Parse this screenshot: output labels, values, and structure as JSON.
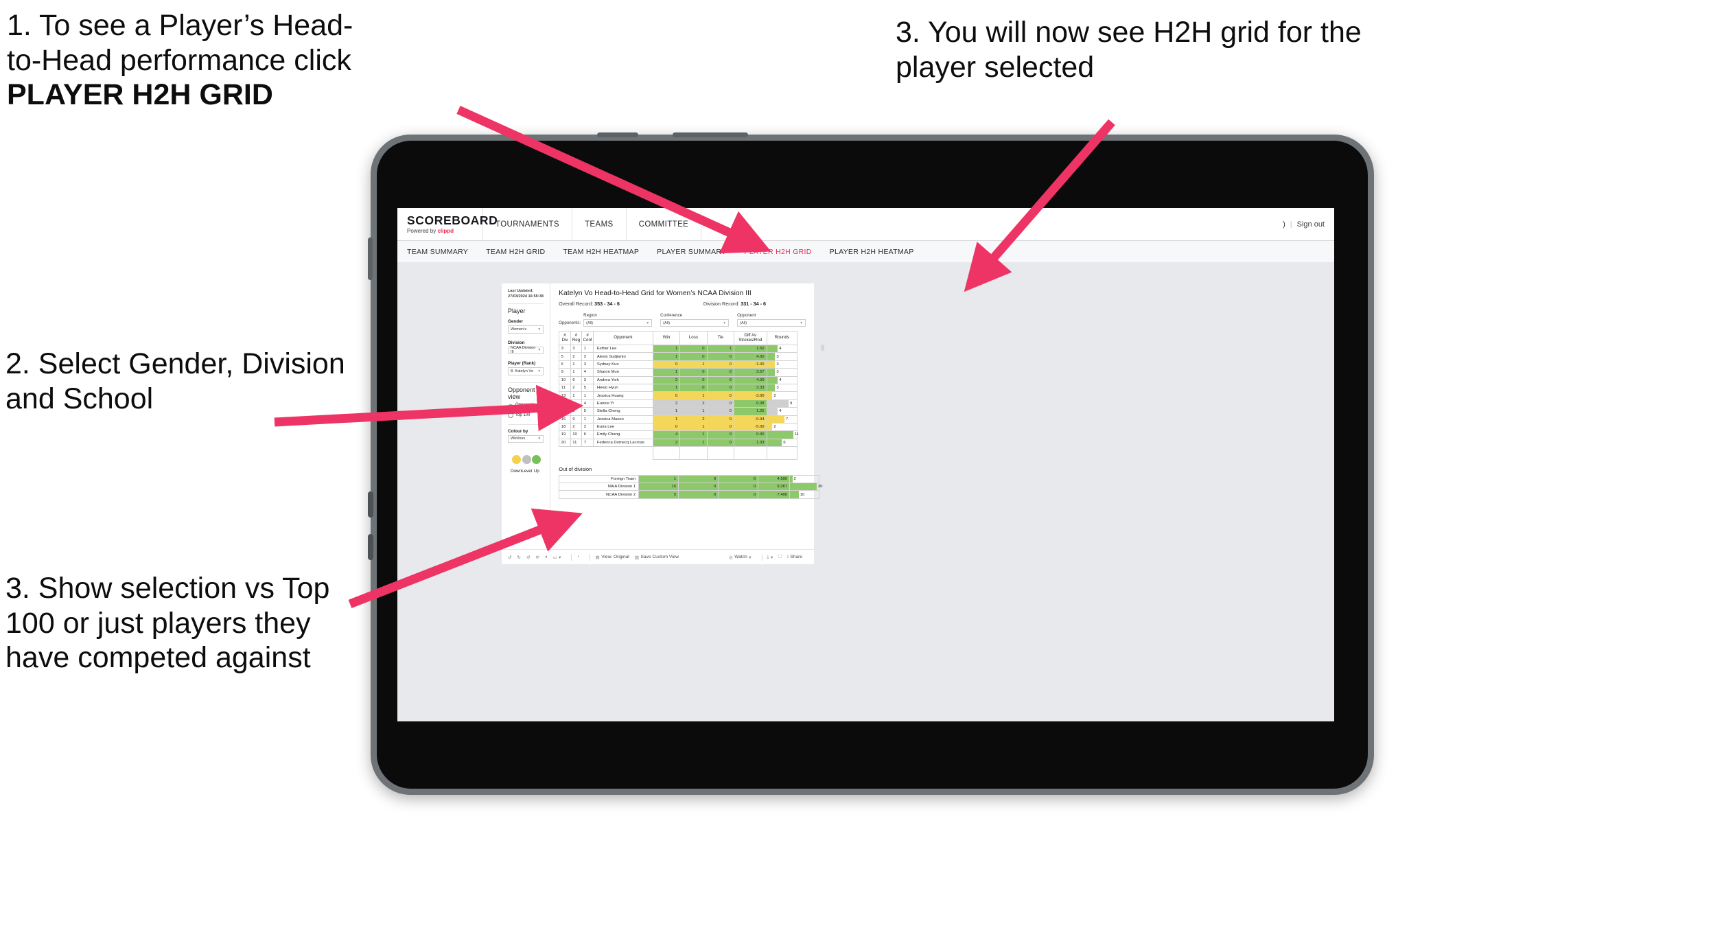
{
  "annotations": {
    "a1_line1": "1. To see a Player’s Head-",
    "a1_line2": "to-Head performance click",
    "a1_bold": "PLAYER H2H GRID",
    "a2": "2. Select Gender, Division and School",
    "a3": "3. Show selection vs Top 100 or just players they have competed against",
    "a4": "3. You will now see H2H grid for the player selected"
  },
  "app": {
    "logo": {
      "main": "SCOREBOARD",
      "sub_prefix": "Powered by ",
      "sub_brand": "clippd"
    },
    "topnav": [
      "TOURNAMENTS",
      "TEAMS",
      "COMMITTEE"
    ],
    "topnav_right": {
      "user": ")",
      "sep": "|",
      "signout": "Sign out"
    },
    "tabs": [
      {
        "label": "TEAM SUMMARY",
        "active": false
      },
      {
        "label": "TEAM H2H GRID",
        "active": false
      },
      {
        "label": "TEAM H2H HEATMAP",
        "active": false
      },
      {
        "label": "PLAYER SUMMARY",
        "active": false
      },
      {
        "label": "PLAYER H2H GRID",
        "active": true
      },
      {
        "label": "PLAYER H2H HEATMAP",
        "active": false
      }
    ],
    "accent": "#ec2a56"
  },
  "filters": {
    "last_updated": "Last Updated: 27/03/2024 16:55:38",
    "heading": "Player",
    "gender_label": "Gender",
    "gender_value": "Women’s",
    "division_label": "Division",
    "division_value": "NCAA Division III",
    "player_label": "Player (Rank)",
    "player_value": "8. Katelyn Vo",
    "opponent_view_heading": "Opponent view",
    "opponent_view_options": [
      {
        "label": "Opponents Played",
        "selected": true
      },
      {
        "label": "Top 100",
        "selected": false
      }
    ],
    "colour_by_label": "Colour by",
    "colour_by_value": "Win/loss",
    "legend": [
      {
        "label": "Down",
        "color": "#f2d council"
      },
      {
        "label": "Level",
        "color": "#bfbfbf"
      },
      {
        "label": "Up",
        "color": "#78c159"
      }
    ],
    "legend_colors": [
      "#f2d24b",
      "#bfbfbf",
      "#78c159"
    ]
  },
  "content": {
    "title": "Katelyn Vo Head-to-Head Grid for Women’s NCAA Division III",
    "overall_record_label": "Overall Record:",
    "overall_record_value": "353 -  34 - 6",
    "division_record_label": "Division Record:",
    "division_record_value": "331 -  34 - 6",
    "opponents_label": "Opponents:",
    "opponent_filters": [
      {
        "label": "Region",
        "value": "(All)"
      },
      {
        "label": "Conference",
        "value": "(All)"
      },
      {
        "label": "Opponent",
        "value": "(All)"
      }
    ],
    "table_headers": [
      "#\nDiv",
      "#\nReg",
      "#\nConf",
      "Opponent",
      "Win",
      "Loss",
      "Tie",
      "Diff Av\nStrokes/Rnd",
      "Rounds"
    ],
    "table_headers_flat": [
      "# Div",
      "# Reg",
      "# Conf",
      "Opponent",
      "Win",
      "Loss",
      "Tie",
      "Diff Av Strokes/Rnd",
      "Rounds"
    ],
    "rows": [
      {
        "div": "3",
        "reg": "3",
        "conf": "1",
        "opponent": "Esther Lee",
        "win": "1",
        "loss": "0",
        "tie": "1",
        "diff": "1.50",
        "rounds": "4",
        "state": "up",
        "bar_pct": 36
      },
      {
        "div": "5",
        "reg": "2",
        "conf": "2",
        "opponent": "Alexis Sudjianto",
        "win": "1",
        "loss": "0",
        "tie": "0",
        "diff": "4.00",
        "rounds": "3",
        "state": "up",
        "bar_pct": 27
      },
      {
        "div": "6",
        "reg": "1",
        "conf": "3",
        "opponent": "Sydney Kuo",
        "win": "0",
        "loss": "1",
        "tie": "0",
        "diff": "-1.00",
        "rounds": "3",
        "state": "down",
        "bar_pct": 27
      },
      {
        "div": "9",
        "reg": "1",
        "conf": "4",
        "opponent": "Sharon Mun",
        "win": "1",
        "loss": "0",
        "tie": "0",
        "diff": "3.67",
        "rounds": "3",
        "state": "up",
        "bar_pct": 27
      },
      {
        "div": "10",
        "reg": "6",
        "conf": "3",
        "opponent": "Andrea York",
        "win": "2",
        "loss": "0",
        "tie": "0",
        "diff": "4.00",
        "rounds": "4",
        "state": "up",
        "bar_pct": 36
      },
      {
        "div": "11",
        "reg": "2",
        "conf": "5",
        "opponent": "Heejo Hyun",
        "win": "1",
        "loss": "0",
        "tie": "0",
        "diff": "3.33",
        "rounds": "3",
        "state": "up",
        "bar_pct": 27
      },
      {
        "div": "13",
        "reg": "1",
        "conf": "1",
        "opponent": "Jessica Huang",
        "win": "0",
        "loss": "1",
        "tie": "0",
        "diff": "-3.00",
        "rounds": "2",
        "state": "down",
        "bar_pct": 18
      },
      {
        "div": "14",
        "reg": "7",
        "conf": "4",
        "opponent": "Eunice Yi",
        "win": "2",
        "loss": "2",
        "tie": "0",
        "diff": "0.38",
        "rounds": "9",
        "state": "level",
        "bar_pct": 72,
        "diff_state": "up"
      },
      {
        "div": "15",
        "reg": "8",
        "conf": "5",
        "opponent": "Stella Cheng",
        "win": "1",
        "loss": "1",
        "tie": "0",
        "diff": "1.25",
        "rounds": "4",
        "state": "level",
        "bar_pct": 36,
        "diff_state": "up"
      },
      {
        "div": "16",
        "reg": "9",
        "conf": "1",
        "opponent": "Jessica Mason",
        "win": "1",
        "loss": "2",
        "tie": "0",
        "diff": "-0.94",
        "rounds": "7",
        "state": "down",
        "bar_pct": 58
      },
      {
        "div": "18",
        "reg": "2",
        "conf": "2",
        "opponent": "Euna Lee",
        "win": "0",
        "loss": "1",
        "tie": "0",
        "diff": "-5.00",
        "rounds": "2",
        "state": "down",
        "bar_pct": 18
      },
      {
        "div": "19",
        "reg": "10",
        "conf": "6",
        "opponent": "Emily Chang",
        "win": "4",
        "loss": "1",
        "tie": "0",
        "diff": "0.30",
        "rounds": "11",
        "state": "up",
        "bar_pct": 88
      },
      {
        "div": "20",
        "reg": "11",
        "conf": "7",
        "opponent": "Federica Domecq Lacroze",
        "win": "2",
        "loss": "1",
        "tie": "0",
        "diff": "1.33",
        "rounds": "6",
        "state": "up",
        "bar_pct": 50
      }
    ],
    "out_of_division_title": "Out of division",
    "out_of_division_rows": [
      {
        "name": "Foreign Team",
        "win": "1",
        "loss": "0",
        "tie": "0",
        "diff": "4.500",
        "rounds": "2",
        "state": "up",
        "bar_pct": 8
      },
      {
        "name": "NAIA Division 1",
        "win": "15",
        "loss": "0",
        "tie": "0",
        "diff": "9.267",
        "rounds": "30",
        "state": "up",
        "bar_pct": 92
      },
      {
        "name": "NCAA Division 2",
        "win": "5",
        "loss": "0",
        "tie": "0",
        "diff": "7.400",
        "rounds": "10",
        "state": "up",
        "bar_pct": 30
      }
    ]
  },
  "toolbar": {
    "view_label": "View: Original",
    "save_label": "Save Custom View",
    "watch_label": "Watch",
    "share_label": "Share"
  },
  "colors": {
    "up": "#8dc96a",
    "down": "#f4d758",
    "level": "#cfcfcf",
    "accent": "#ec2a56",
    "arrow": "#ee3465"
  }
}
